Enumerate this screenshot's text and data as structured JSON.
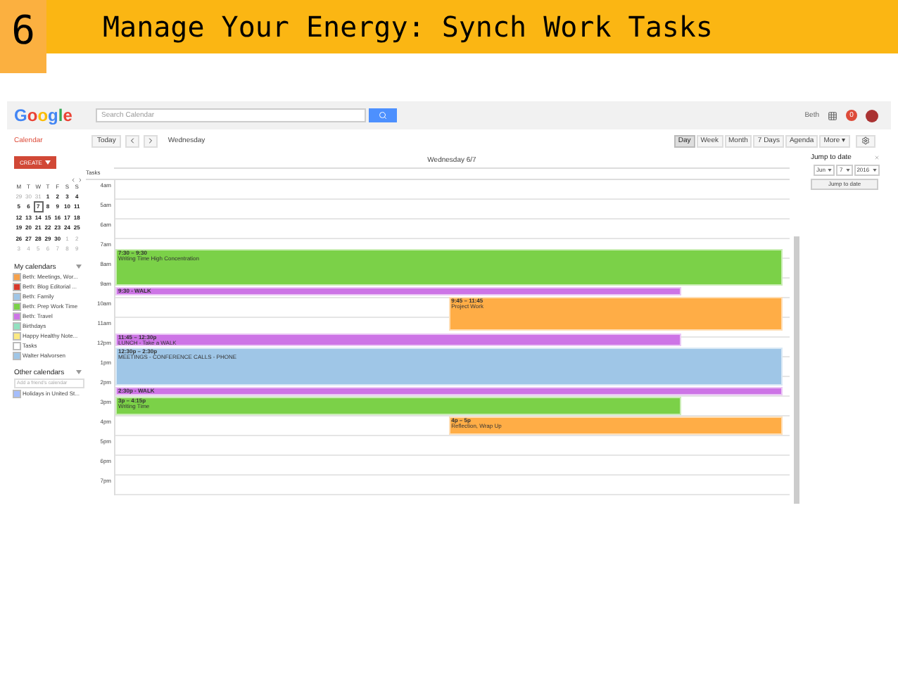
{
  "slide": {
    "number": "6",
    "title": "Manage Your Energy: Synch Work Tasks"
  },
  "topbar": {
    "logo": "Google",
    "search": {
      "placeholder": "Search Calendar"
    },
    "user": "Beth",
    "notifications": "0"
  },
  "toolbar": {
    "app": "Calendar",
    "today": "Today",
    "date_label": "Wednesday",
    "views": [
      {
        "label": "Day",
        "selected": true
      },
      {
        "label": "Week",
        "selected": false
      },
      {
        "label": "Month",
        "selected": false
      },
      {
        "label": "7 Days",
        "selected": false
      },
      {
        "label": "Agenda",
        "selected": false
      },
      {
        "label": "More ▾",
        "selected": false
      }
    ]
  },
  "create": "CREATE",
  "mini_calendar": {
    "weekdays": [
      "M",
      "T",
      "W",
      "T",
      "F",
      "S",
      "S"
    ],
    "weeks": [
      [
        {
          "day": "29",
          "other_month": true,
          "selected": false
        },
        {
          "day": "30",
          "other_month": true,
          "selected": false
        },
        {
          "day": "31",
          "other_month": true,
          "selected": false
        },
        {
          "day": "1",
          "other_month": false,
          "selected": false
        },
        {
          "day": "2",
          "other_month": false,
          "selected": false
        },
        {
          "day": "3",
          "other_month": false,
          "selected": false
        },
        {
          "day": "4",
          "other_month": false,
          "selected": false
        }
      ],
      [
        {
          "day": "5",
          "other_month": false,
          "selected": false
        },
        {
          "day": "6",
          "other_month": false,
          "selected": false
        },
        {
          "day": "7",
          "other_month": false,
          "selected": true
        },
        {
          "day": "8",
          "other_month": false,
          "selected": false
        },
        {
          "day": "9",
          "other_month": false,
          "selected": false
        },
        {
          "day": "10",
          "other_month": false,
          "selected": false
        },
        {
          "day": "11",
          "other_month": false,
          "selected": false
        }
      ],
      [
        {
          "day": "12",
          "other_month": false,
          "selected": false
        },
        {
          "day": "13",
          "other_month": false,
          "selected": false
        },
        {
          "day": "14",
          "other_month": false,
          "selected": false
        },
        {
          "day": "15",
          "other_month": false,
          "selected": false
        },
        {
          "day": "16",
          "other_month": false,
          "selected": false
        },
        {
          "day": "17",
          "other_month": false,
          "selected": false
        },
        {
          "day": "18",
          "other_month": false,
          "selected": false
        }
      ],
      [
        {
          "day": "19",
          "other_month": false,
          "selected": false
        },
        {
          "day": "20",
          "other_month": false,
          "selected": false
        },
        {
          "day": "21",
          "other_month": false,
          "selected": false
        },
        {
          "day": "22",
          "other_month": false,
          "selected": false
        },
        {
          "day": "23",
          "other_month": false,
          "selected": false
        },
        {
          "day": "24",
          "other_month": false,
          "selected": false
        },
        {
          "day": "25",
          "other_month": false,
          "selected": false
        }
      ],
      [
        {
          "day": "26",
          "other_month": false,
          "selected": false
        },
        {
          "day": "27",
          "other_month": false,
          "selected": false
        },
        {
          "day": "28",
          "other_month": false,
          "selected": false
        },
        {
          "day": "29",
          "other_month": false,
          "selected": false
        },
        {
          "day": "30",
          "other_month": false,
          "selected": false
        },
        {
          "day": "1",
          "other_month": true,
          "selected": false
        },
        {
          "day": "2",
          "other_month": true,
          "selected": false
        }
      ],
      [
        {
          "day": "3",
          "other_month": true,
          "selected": false
        },
        {
          "day": "4",
          "other_month": true,
          "selected": false
        },
        {
          "day": "5",
          "other_month": true,
          "selected": false
        },
        {
          "day": "6",
          "other_month": true,
          "selected": false
        },
        {
          "day": "7",
          "other_month": true,
          "selected": false
        },
        {
          "day": "8",
          "other_month": true,
          "selected": false
        },
        {
          "day": "9",
          "other_month": true,
          "selected": false
        }
      ]
    ]
  },
  "my_calendars": {
    "title": "My calendars",
    "items": [
      {
        "name": "Beth: Meetings, Wor...",
        "color": "#f6a14b"
      },
      {
        "name": "Beth: Blog Editorial ...",
        "color": "#d8392c"
      },
      {
        "name": "Beth: Family",
        "color": "#9fc6e7"
      },
      {
        "name": "Beth: Prep Work Time",
        "color": "#7bd148"
      },
      {
        "name": "Beth: Travel",
        "color": "#cd74e6"
      },
      {
        "name": "Birthdays",
        "color": "#92e1c0"
      },
      {
        "name": "Happy Healthy Note...",
        "color": "#fbe983"
      },
      {
        "name": "Tasks",
        "color": "#ffffff"
      },
      {
        "name": "Walter Halvorsen",
        "color": "#9fc6e7"
      }
    ]
  },
  "other_calendars": {
    "title": "Other calendars",
    "add": {
      "placeholder": "Add a friend's calendar"
    },
    "items": [
      {
        "name": "Holidays in United St...",
        "color": "#a4bdfc"
      }
    ]
  },
  "day_view": {
    "header": "Wednesday 6/7",
    "tasks_label": "Tasks",
    "hours": [
      "4am",
      "5am",
      "6am",
      "7am",
      "8am",
      "9am",
      "10am",
      "11am",
      "12pm",
      "1pm",
      "2pm",
      "3pm",
      "4pm",
      "5pm",
      "6pm",
      "7pm"
    ],
    "events": [
      {
        "time": "7:30 – 9:30",
        "title": "Writing Time High Concentration",
        "color": "#7bd148"
      },
      {
        "time": "9:30 - WALK",
        "color": "#cd74e6"
      },
      {
        "time": "9:45 – 11:45",
        "title": "Project Work",
        "color": "#ffad46"
      },
      {
        "time": "11:45 – 12:30p",
        "title": "LUNCH - Take a WALK",
        "color": "#cd74e6"
      },
      {
        "time": "12:30p – 2:30p",
        "title": "MEETINGS - CONFERENCE CALLS - PHONE",
        "color": "#9fc6e7"
      },
      {
        "time": "2:30p - WALK",
        "color": "#cd74e6"
      },
      {
        "time": "3p – 4:15p",
        "title": "Writing Time",
        "color": "#7bd148"
      },
      {
        "time": "4p – 5p",
        "title": "Reflection, Wrap Up",
        "color": "#ffad46"
      }
    ]
  },
  "jump_to_date": {
    "title": "Jump to date",
    "month": "Jun",
    "day": "7",
    "year": "2016",
    "button": "Jump to date"
  }
}
